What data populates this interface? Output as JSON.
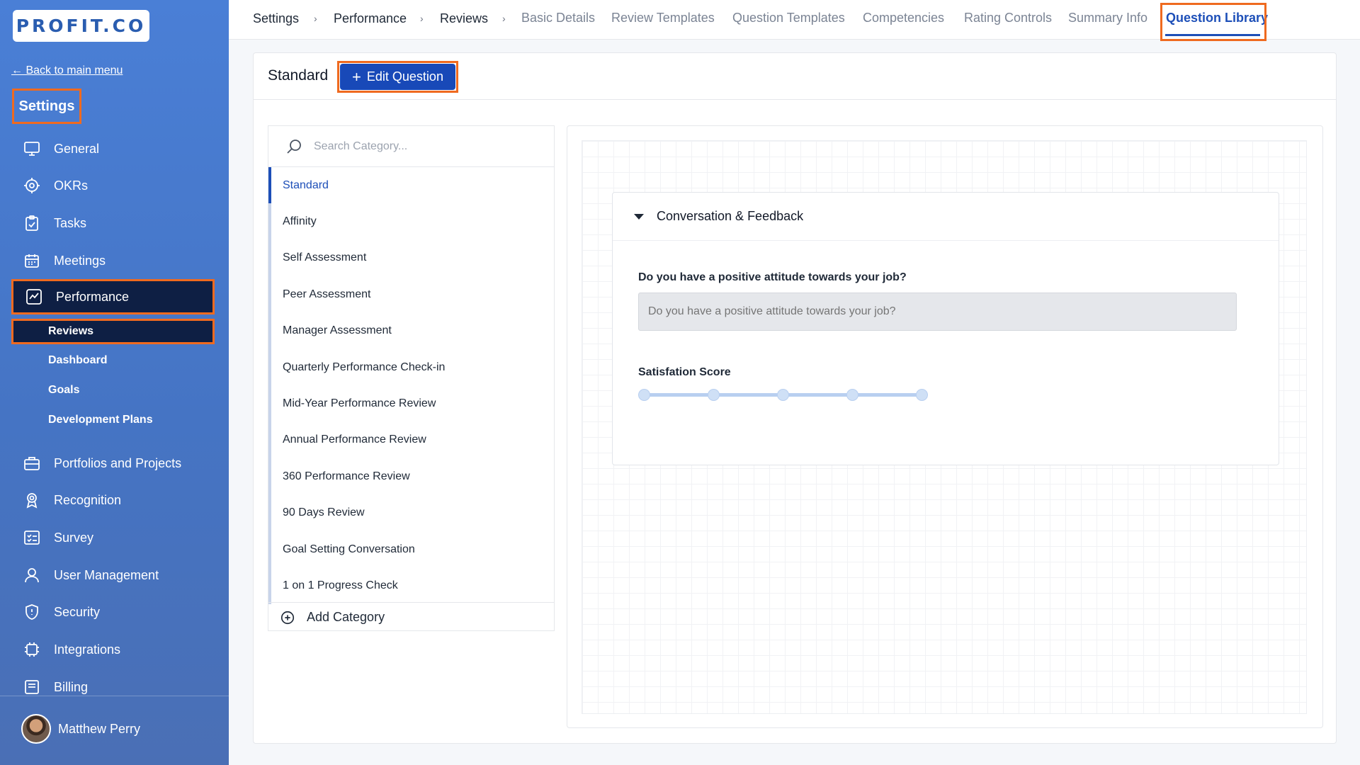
{
  "brand": {
    "logo_text": "PROFIT.CO"
  },
  "sidebar": {
    "back_label": "← Back to main menu",
    "title": "Settings",
    "items": [
      {
        "label": "General",
        "icon": "monitor-icon"
      },
      {
        "label": "OKRs",
        "icon": "target-icon"
      },
      {
        "label": "Tasks",
        "icon": "clipboard-check-icon"
      },
      {
        "label": "Meetings",
        "icon": "calendar-icon"
      },
      {
        "label": "Performance",
        "icon": "chart-line-icon"
      }
    ],
    "performance_sub": [
      {
        "label": "Reviews"
      },
      {
        "label": "Dashboard"
      },
      {
        "label": "Goals"
      },
      {
        "label": "Development Plans"
      }
    ],
    "items_lower": [
      {
        "label": "Portfolios and Projects",
        "icon": "briefcase-icon"
      },
      {
        "label": "Recognition",
        "icon": "award-icon"
      },
      {
        "label": "Survey",
        "icon": "checklist-icon"
      },
      {
        "label": "User Management",
        "icon": "user-icon"
      },
      {
        "label": "Security",
        "icon": "shield-icon"
      },
      {
        "label": "Integrations",
        "icon": "chip-icon"
      },
      {
        "label": "Billing",
        "icon": "billing-icon"
      }
    ],
    "user": {
      "name": "Matthew Perry"
    }
  },
  "topbar": {
    "breadcrumbs": [
      "Settings",
      "Performance",
      "Reviews"
    ],
    "tabs": [
      "Basic Details",
      "Review Templates",
      "Question Templates",
      "Competencies",
      "Rating Controls",
      "Summary Info",
      "Question Library"
    ],
    "active_tab": "Question Library"
  },
  "main": {
    "title": "Standard",
    "edit_button": "Edit Question",
    "search_placeholder": "Search Category...",
    "categories": [
      "Standard",
      "Affinity",
      "Self Assessment",
      "Peer Assessment",
      "Manager Assessment",
      "Quarterly Performance Check-in",
      "Mid-Year Performance Review",
      "Annual Performance Review",
      "360 Performance Review",
      "90 Days Review",
      "Goal Setting Conversation",
      "1 on 1 Progress Check"
    ],
    "active_category": "Standard",
    "add_category": "Add Category",
    "section": {
      "title": "Conversation & Feedback",
      "question_label": "Do you have a positive attitude towards your job?",
      "question_placeholder": "Do you have a positive attitude towards your job?",
      "score_label": "Satisfation Score",
      "score_points": 5
    }
  },
  "colors": {
    "accent": "#1d4fb8",
    "highlight": "#ef6a1f",
    "sidebar_active": "#0e1f44"
  }
}
